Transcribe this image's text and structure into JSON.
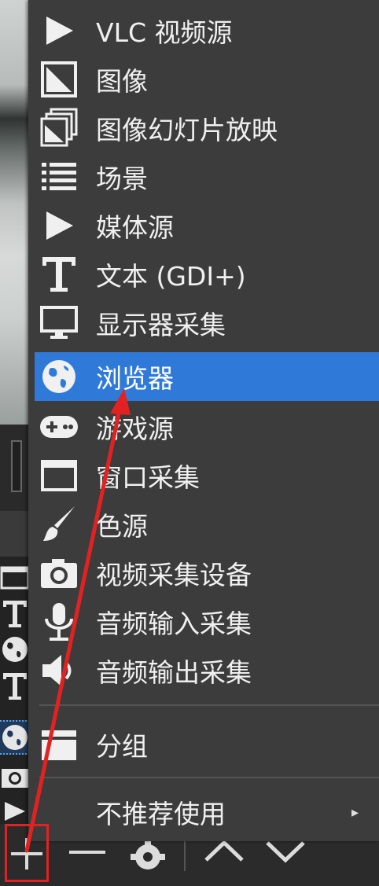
{
  "context_menu": {
    "items": [
      {
        "label": "VLC 视频源",
        "icon": "play-icon"
      },
      {
        "label": "图像",
        "icon": "image-icon"
      },
      {
        "label": "图像幻灯片放映",
        "icon": "slideshow-icon"
      },
      {
        "label": "场景",
        "icon": "list-icon"
      },
      {
        "label": "媒体源",
        "icon": "play-icon"
      },
      {
        "label": "文本 (GDI+)",
        "icon": "text-icon"
      },
      {
        "label": "显示器采集",
        "icon": "monitor-icon"
      },
      {
        "label": "浏览器",
        "icon": "globe-icon",
        "selected": true
      },
      {
        "label": "游戏源",
        "icon": "gamepad-icon"
      },
      {
        "label": "窗口采集",
        "icon": "window-icon"
      },
      {
        "label": "色源",
        "icon": "brush-icon"
      },
      {
        "label": "视频采集设备",
        "icon": "camera-icon"
      },
      {
        "label": "音频输入采集",
        "icon": "microphone-icon"
      },
      {
        "label": "音频输出采集",
        "icon": "speaker-icon"
      },
      {
        "label": "分组",
        "icon": "folder-icon"
      },
      {
        "label": "不推荐使用",
        "icon": "",
        "submenu": true
      }
    ],
    "submenu_arrow": "▸"
  },
  "toolbar": {
    "buttons": [
      "add-source",
      "remove-source",
      "source-properties",
      "move-up",
      "move-down"
    ]
  },
  "annotation": {
    "color": "#e22222",
    "highlight_target": "add-source-button",
    "points_to": "浏览器"
  },
  "colors": {
    "menu_bg": "#3c3c3c",
    "selected_bg": "#2f7ad9",
    "text": "#f0f0f0"
  }
}
